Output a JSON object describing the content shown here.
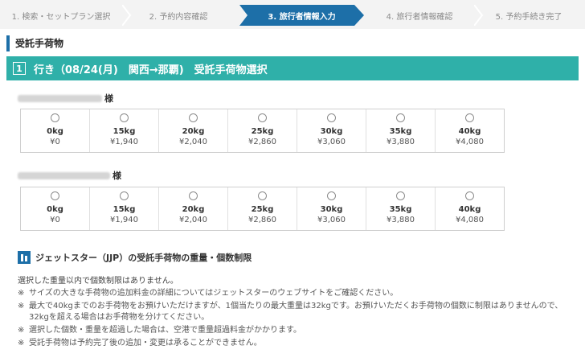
{
  "stepper": {
    "steps": [
      {
        "label": "1. 検索・セットプラン選択",
        "active": false
      },
      {
        "label": "2. 予約内容確認",
        "active": false
      },
      {
        "label": "3. 旅行者情報入力",
        "active": true
      },
      {
        "label": "4. 旅行者情報確認",
        "active": false
      },
      {
        "label": "5. 予約手続き完了",
        "active": false
      }
    ],
    "active_color": "#1d6fa8",
    "inactive_color": "#f3f3f3"
  },
  "section_title": "受託手荷物",
  "trip": {
    "number": "1",
    "title": "行き（08/24(月)　関西→那覇)　受託手荷物選択",
    "header_color": "#2fb0a9"
  },
  "passengers": [
    {
      "suffix": "様",
      "options": [
        {
          "weight": "0kg",
          "price": "¥0"
        },
        {
          "weight": "15kg",
          "price": "¥1,940"
        },
        {
          "weight": "20kg",
          "price": "¥2,040"
        },
        {
          "weight": "25kg",
          "price": "¥2,860"
        },
        {
          "weight": "30kg",
          "price": "¥3,060"
        },
        {
          "weight": "35kg",
          "price": "¥3,880"
        },
        {
          "weight": "40kg",
          "price": "¥4,080"
        }
      ]
    },
    {
      "suffix": "様",
      "options": [
        {
          "weight": "0kg",
          "price": "¥0"
        },
        {
          "weight": "15kg",
          "price": "¥1,940"
        },
        {
          "weight": "20kg",
          "price": "¥2,040"
        },
        {
          "weight": "25kg",
          "price": "¥2,860"
        },
        {
          "weight": "30kg",
          "price": "¥3,060"
        },
        {
          "weight": "35kg",
          "price": "¥3,880"
        },
        {
          "weight": "40kg",
          "price": "¥4,080"
        }
      ]
    }
  ],
  "airline_info": {
    "icon": "building-icon",
    "title": "ジェットスター（JJP）の受託手荷物の重量・個数制限",
    "main_note": "選択した重量以内で個数制限はありません。",
    "notes": [
      {
        "mark": "※",
        "text": "サイズの大きな手荷物の追加料金の詳細についてはジェットスターのウェブサイトをご確認ください。",
        "cont": ""
      },
      {
        "mark": "※",
        "text": "最大で40kgまでのお手荷物をお預けいただけますが、1個当たりの最大重量は32kgです。お預けいただくお手荷物の個数に制限はありませんので、",
        "cont": "32kgを超える場合はお手荷物を分けてください。"
      },
      {
        "mark": "※",
        "text": "選択した個数・重量を超過した場合は、空港で重量超過料金がかかります。",
        "cont": ""
      },
      {
        "mark": "※",
        "text": "受託手荷物は予約完了後の追加・変更は承ることができません。",
        "cont": ""
      }
    ]
  }
}
